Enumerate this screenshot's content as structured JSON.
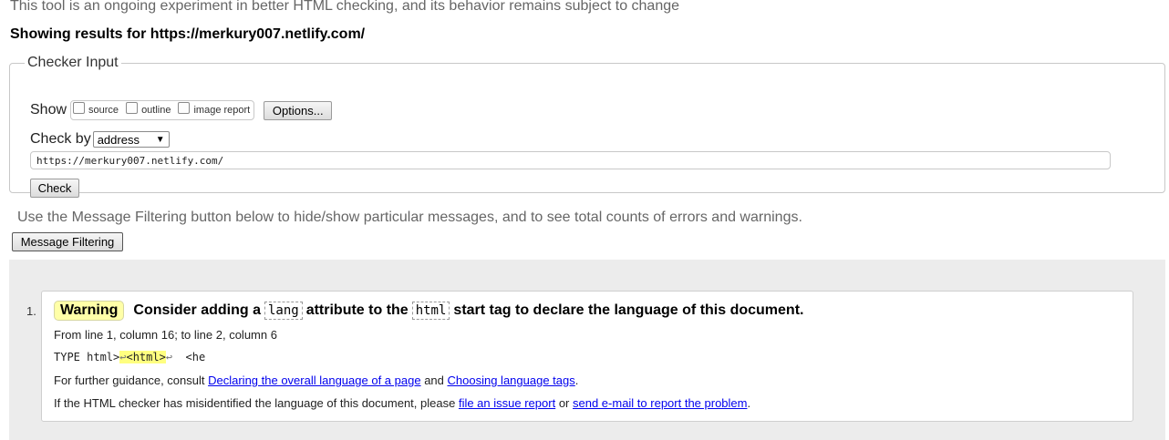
{
  "intro": "This tool is an ongoing experiment in better HTML checking, and its behavior remains subject to change",
  "showing": "Showing results for https://merkury007.netlify.com/",
  "checker": {
    "legend": "Checker Input",
    "show_label": "Show",
    "options": [
      {
        "label": "source",
        "checked": false
      },
      {
        "label": "outline",
        "checked": false
      },
      {
        "label": "image report",
        "checked": false
      }
    ],
    "options_button": "Options...",
    "check_by_label": "Check by",
    "check_by_value": "address",
    "url_value": "https://merkury007.netlify.com/",
    "check_button": "Check"
  },
  "filter": {
    "text": "Use the Message Filtering button below to hide/show particular messages, and to see total counts of errors and warnings.",
    "button": "Message Filtering"
  },
  "message": {
    "number": "1.",
    "type": "Warning",
    "title_a": "Consider adding a",
    "code1": "lang",
    "title_b": "attribute to the",
    "code2": "html",
    "title_c": "start tag to declare the language of this document.",
    "location": "From line 1, column 16; to line 2, column 6",
    "extract_pre": "TYPE html>",
    "extract_lf1": "↩",
    "extract_hl": "<html>",
    "extract_lf2": "↩",
    "extract_post": "  <he",
    "guidance_pre": "For further guidance, consult",
    "link1": "Declaring the overall language of a page",
    "guidance_and": "and",
    "link2": "Choosing language tags",
    "guidance_end": ".",
    "misid_pre": "If the HTML checker has misidentified the language of this document, please",
    "link3": "file an issue report",
    "misid_or": "or",
    "link4": "send e-mail to report the problem",
    "misid_end": "."
  },
  "colors": {
    "warning_bg": "#ffffa8",
    "link": "#0000ee",
    "results_bg": "#ececec"
  }
}
